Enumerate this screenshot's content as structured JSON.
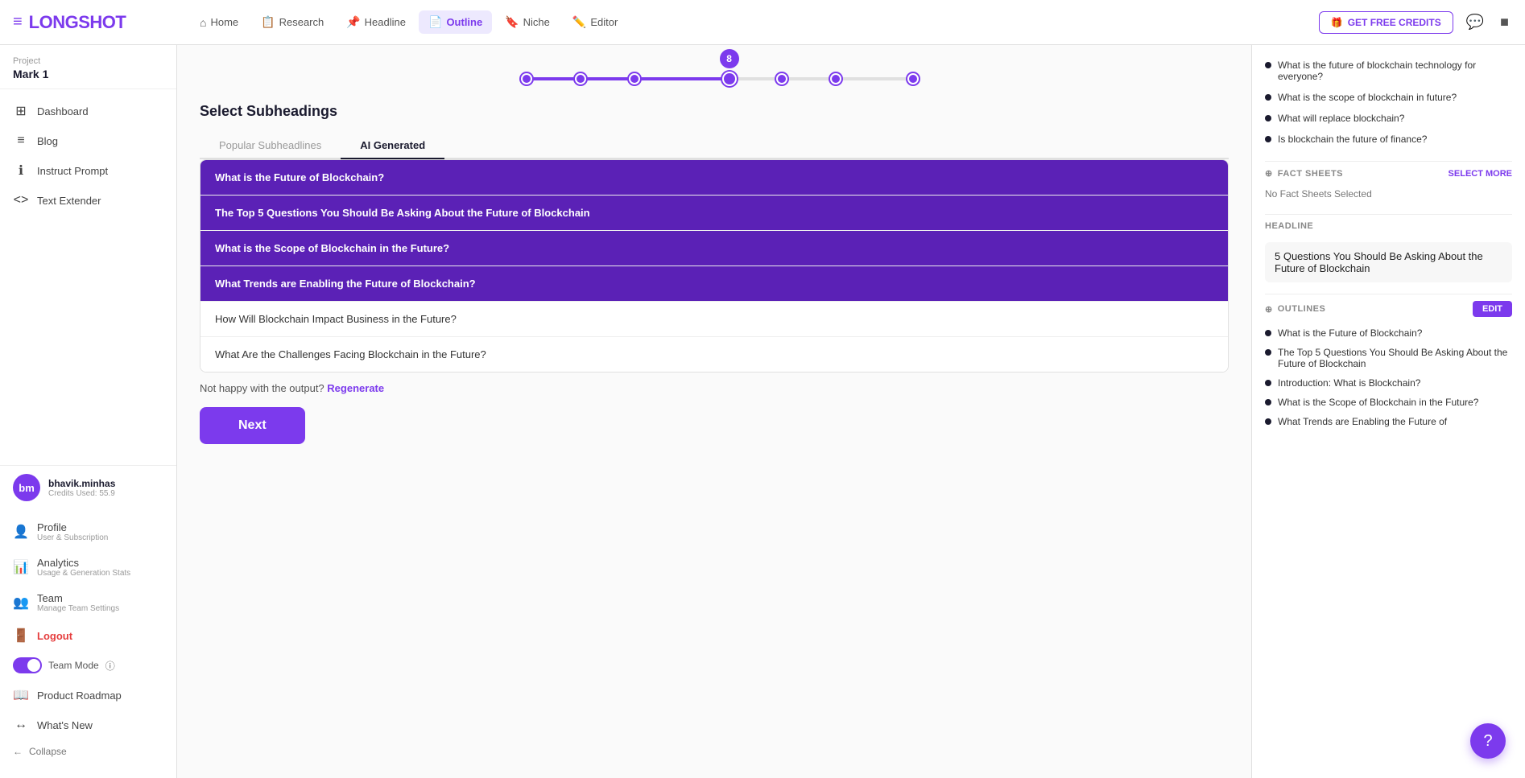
{
  "logo": {
    "icon": "≡",
    "text_part1": "LONG",
    "text_part2": "SHOT"
  },
  "nav": {
    "items": [
      {
        "id": "home",
        "label": "Home",
        "icon": "⌂",
        "active": false
      },
      {
        "id": "research",
        "label": "Research",
        "icon": "📋",
        "active": false
      },
      {
        "id": "headline",
        "label": "Headline",
        "icon": "📌",
        "active": false
      },
      {
        "id": "outline",
        "label": "Outline",
        "icon": "📄",
        "active": true
      },
      {
        "id": "niche",
        "label": "Niche",
        "icon": "🔖",
        "active": false
      },
      {
        "id": "editor",
        "label": "Editor",
        "icon": "✏️",
        "active": false
      }
    ],
    "credits_btn": "GET FREE CREDITS"
  },
  "sidebar": {
    "project_label": "Project",
    "project_name": "Mark 1",
    "items": [
      {
        "id": "dashboard",
        "label": "Dashboard",
        "icon": "⊞"
      },
      {
        "id": "blog",
        "label": "Blog",
        "icon": "≡"
      },
      {
        "id": "instruct-prompt",
        "label": "Instruct Prompt",
        "icon": "ℹ"
      },
      {
        "id": "text-extender",
        "label": "Text Extender",
        "icon": "<>"
      }
    ],
    "user": {
      "initials": "bm",
      "name": "bhavik.minhas",
      "credits": "Credits Used: 55.9"
    },
    "bottom_items": [
      {
        "id": "profile",
        "label": "Profile",
        "sublabel": "User & Subscription",
        "icon": "👤"
      },
      {
        "id": "analytics",
        "label": "Analytics",
        "sublabel": "Usage & Generation Stats",
        "icon": "📊"
      },
      {
        "id": "team",
        "label": "Team",
        "sublabel": "Manage Team Settings",
        "icon": "👥"
      },
      {
        "id": "logout",
        "label": "Logout",
        "icon": "🚪",
        "is_logout": true
      }
    ],
    "team_mode_label": "Team Mode",
    "team_mode_info": "ⓘ",
    "product_roadmap_label": "Product Roadmap",
    "whats_new_label": "What's New",
    "collapse_label": "Collapse"
  },
  "stepper": {
    "step_number": "8",
    "fill_percent": 52
  },
  "main": {
    "section_title": "Select Subheadings",
    "tabs": [
      {
        "id": "popular",
        "label": "Popular Subheadlines",
        "active": false
      },
      {
        "id": "ai",
        "label": "AI Generated",
        "active": true
      }
    ],
    "subheadings": [
      {
        "id": 1,
        "text": "What is the Future of Blockchain?",
        "selected": true
      },
      {
        "id": 2,
        "text": "The Top 5 Questions You Should Be Asking About the Future of Blockchain",
        "selected": true
      },
      {
        "id": 3,
        "text": "What is the Scope of Blockchain in the Future?",
        "selected": true
      },
      {
        "id": 4,
        "text": "What Trends are Enabling the Future of Blockchain?",
        "selected": true
      },
      {
        "id": 5,
        "text": "How Will Blockchain Impact Business in the Future?",
        "selected": false
      },
      {
        "id": 6,
        "text": "What Are the Challenges Facing Blockchain in the Future?",
        "selected": false
      }
    ],
    "not_happy_text": "Not happy with the output?",
    "regenerate_label": "Regenerate",
    "next_label": "Next"
  },
  "right_panel": {
    "top_questions": [
      {
        "text": "What is the future of blockchain technology for everyone?"
      },
      {
        "text": "What is the scope of blockchain in future?"
      },
      {
        "text": "What will replace blockchain?"
      },
      {
        "text": "Is blockchain the future of finance?"
      }
    ],
    "fact_sheets": {
      "label": "FACT SHEETS",
      "action": "SELECT MORE",
      "empty_text": "No Fact Sheets Selected"
    },
    "headline": {
      "label": "HEADLINE",
      "text": "5 Questions You Should Be Asking About the Future of Blockchain"
    },
    "outlines": {
      "label": "OUTLINES",
      "edit_label": "EDIT",
      "items": [
        {
          "text": "What is the Future of Blockchain?"
        },
        {
          "text": "The Top 5 Questions You Should Be Asking About the Future of Blockchain"
        },
        {
          "text": "Introduction: What is Blockchain?"
        },
        {
          "text": "What is the Scope of Blockchain in the Future?"
        },
        {
          "text": "What Trends are Enabling the Future of"
        }
      ]
    }
  },
  "help_icon": "?"
}
